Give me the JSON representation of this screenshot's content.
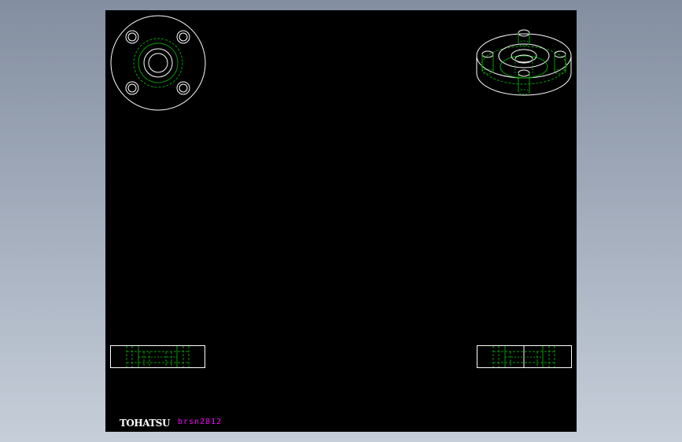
{
  "title_block": {
    "brand": "TOHATSU",
    "drawing_number": "brsn2812"
  },
  "views": [
    {
      "name": "top-view",
      "description": "flange plan view with four bolt holes"
    },
    {
      "name": "isometric-view",
      "description": "flange isometric view"
    },
    {
      "name": "front-section-view",
      "description": "flange section view"
    },
    {
      "name": "side-section-view",
      "description": "flange section view"
    }
  ],
  "colors": {
    "background": "#000000",
    "outline": "#ffffff",
    "hidden_lines": "#00a000",
    "drawing_number": "#ff00ff",
    "window_gradient_top": "#838ea0",
    "window_gradient_bottom": "#c6ced9"
  }
}
